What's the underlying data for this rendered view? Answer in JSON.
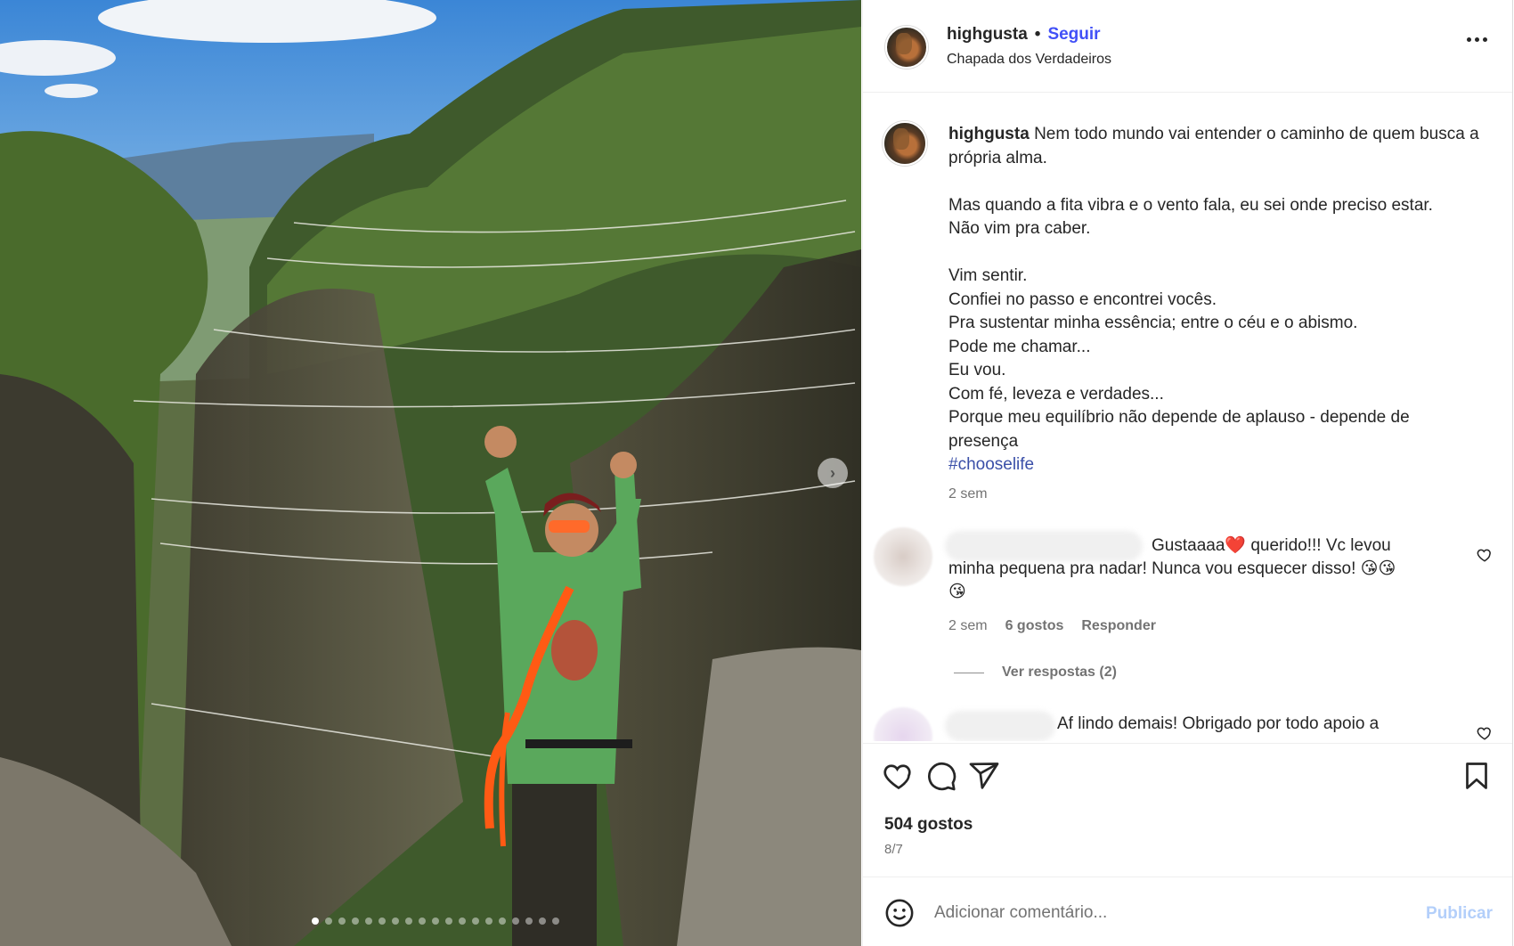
{
  "post": {
    "username": "highgusta",
    "separator": "•",
    "follow_label": "Seguir",
    "location": "Chapada dos Verdadeiros",
    "caption_lines": [
      "Nem todo mundo vai entender o caminho de quem busca a própria alma.",
      "",
      "Mas quando a fita vibra e o vento fala, eu sei onde preciso estar.",
      "Não vim pra caber.",
      "",
      "Vim sentir.",
      "Confiei no passo e encontrei vocês.",
      "Pra sustentar minha essência; entre o céu e o abismo.",
      "Pode me chamar...",
      "Eu vou.",
      "Com fé, leveza e verdades...",
      "Porque meu equilíbrio não depende de aplauso - depende de presença"
    ],
    "hashtag": "#chooselife",
    "caption_time": "2 sem",
    "likes": "504 gostos",
    "date": "8/7"
  },
  "comments": [
    {
      "text_line1": "Gustaaaa❤️ querido!!! Vc levou",
      "text_line2": "minha pequena pra nadar! Nunca vou esquecer disso! 😘😘",
      "text_line3": "😘",
      "time": "2 sem",
      "likes": "6 gostos",
      "reply_label": "Responder",
      "view_replies": "Ver respostas (2)"
    },
    {
      "text_line1": "Af lindo demais! Obrigado por todo apoio a"
    }
  ],
  "add_comment": {
    "placeholder": "Adicionar comentário...",
    "publish_label": "Publicar"
  },
  "carousel": {
    "total": 19,
    "active_index": 0
  },
  "colors": {
    "link": "#4150f7",
    "hashtag": "#3a4fa8",
    "publish_disabled": "#b3cffa",
    "secondary_text": "#737373"
  }
}
